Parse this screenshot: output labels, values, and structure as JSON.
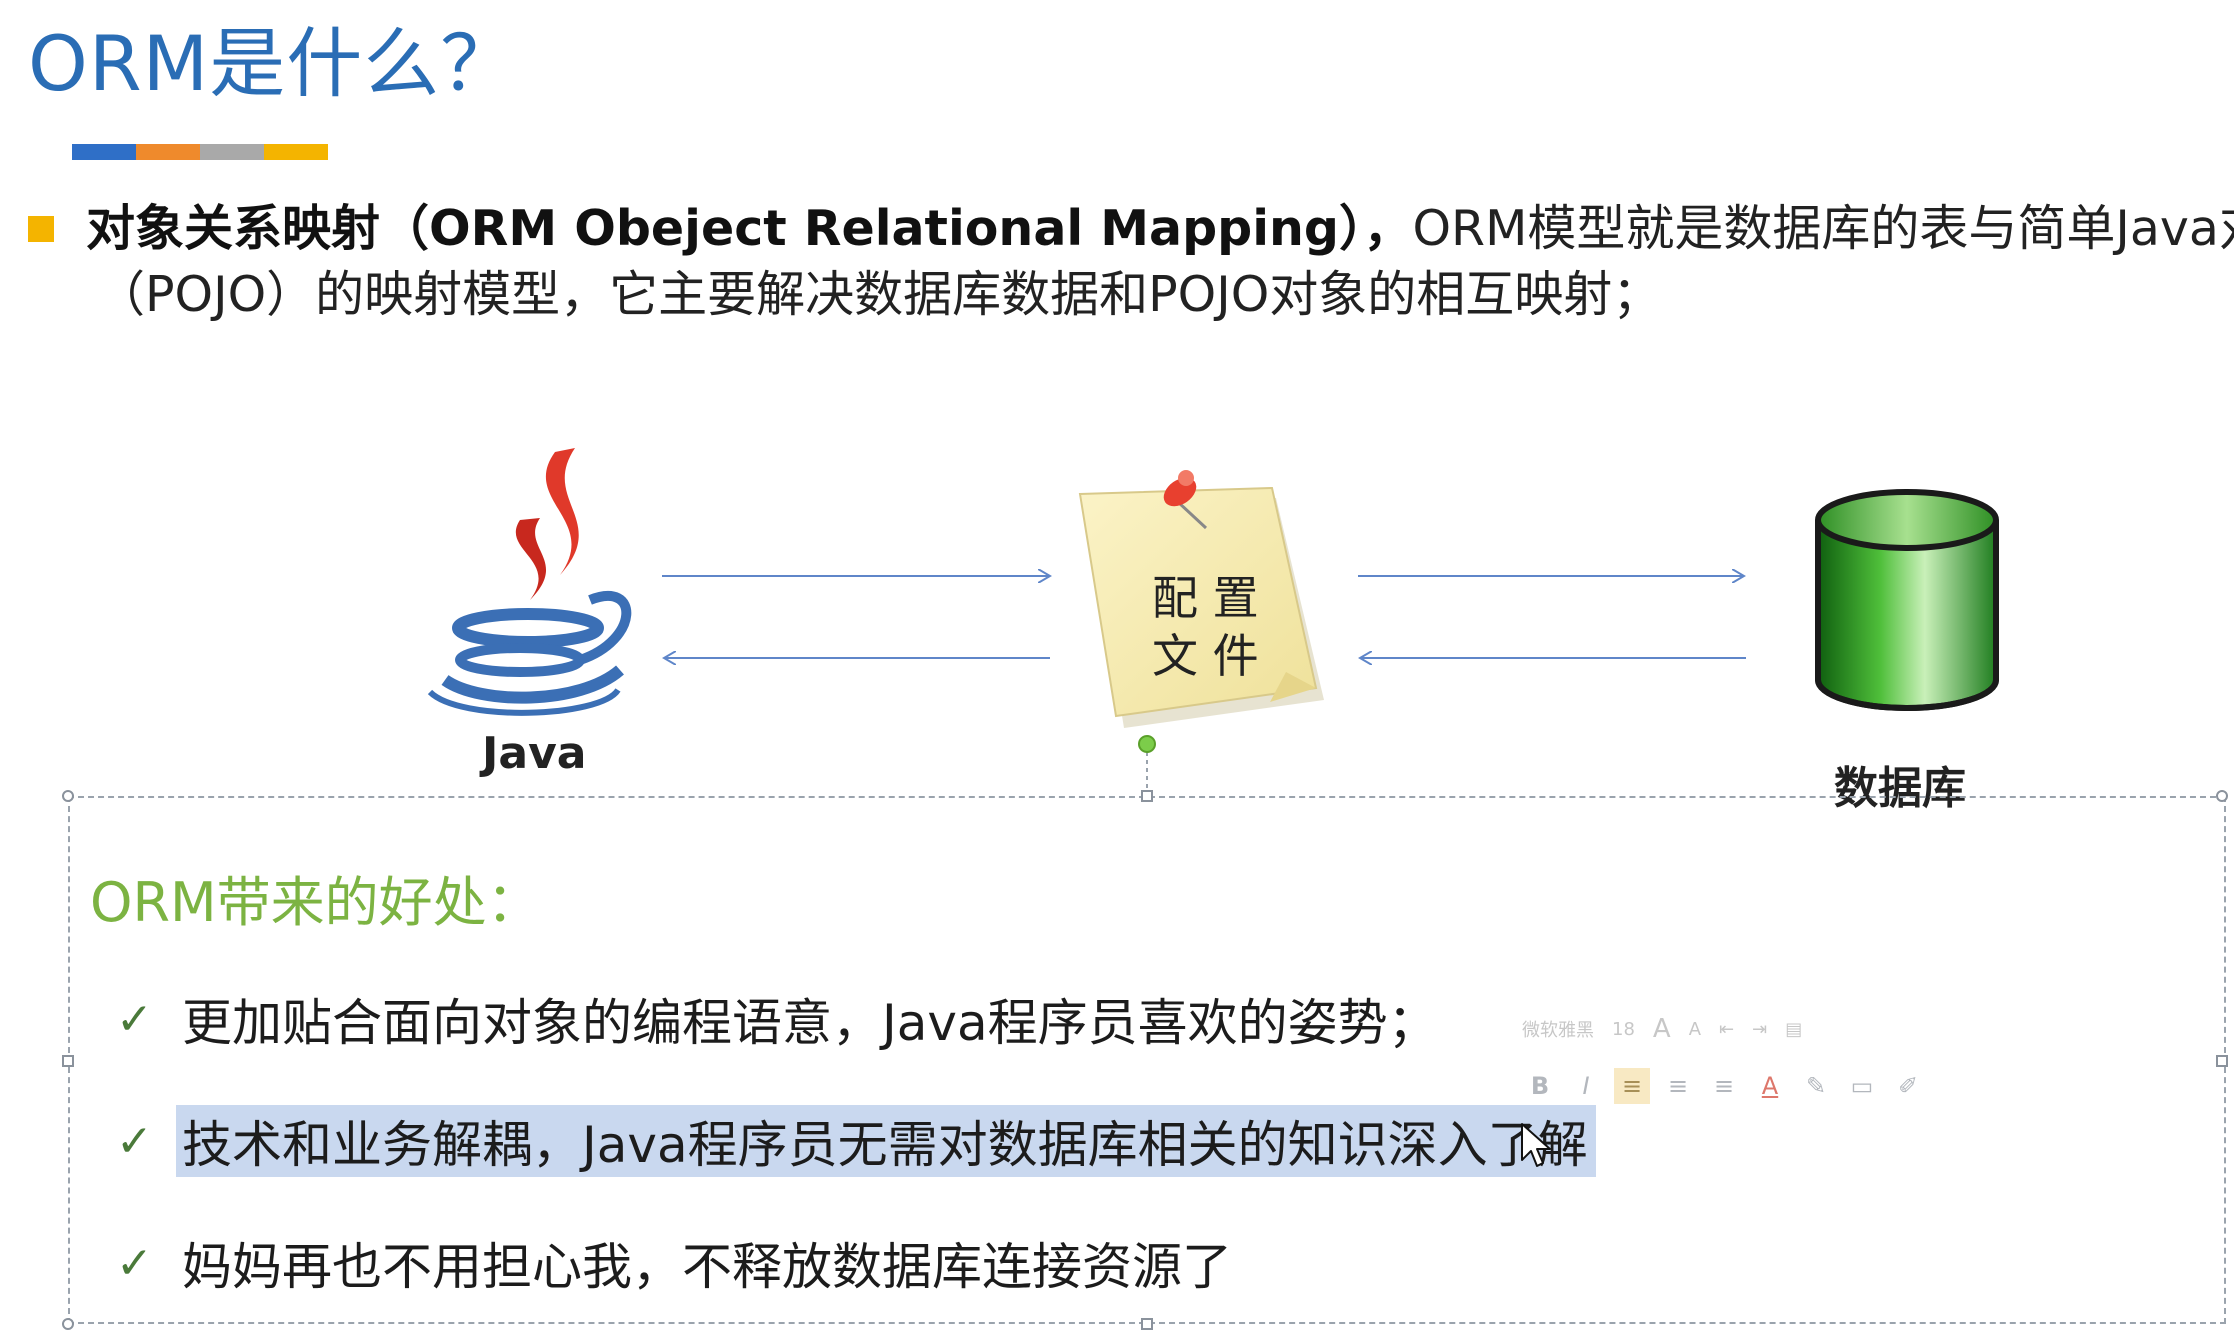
{
  "slide": {
    "title": "ORM是什么？",
    "title_bar_colors": [
      "#2f6fc7",
      "#ef8a2c",
      "#a9a9a9",
      "#f4b400"
    ],
    "intro": {
      "bold": "对象关系映射（ORM Obeject Relational Mapping），",
      "rest": "ORM模型就是数据库的表与简单Java对",
      "line2": "（POJO）的映射模型，它主要解决数据库数据和POJO对象的相互映射；"
    },
    "diagram": {
      "java_label": "Java",
      "config_label_line1": "配 置",
      "config_label_line2": "文 件",
      "db_label": "数据库"
    },
    "benefits": {
      "title": "ORM带来的好处：",
      "items": [
        "更加贴合面向对象的编程语意，Java程序员喜欢的姿势；",
        "技术和业务解耦，Java程序员无需对数据库相关的知识深入了解",
        "妈妈再也不用担心我，不释放数据库连接资源了"
      ],
      "check_symbol": "✓"
    },
    "mini_toolbar": {
      "font_name": "微软雅黑",
      "font_size": "18",
      "grow_font": "A",
      "shrink_font": "A",
      "bold": "B",
      "italic": "I",
      "font_color_glyph": "A"
    }
  }
}
